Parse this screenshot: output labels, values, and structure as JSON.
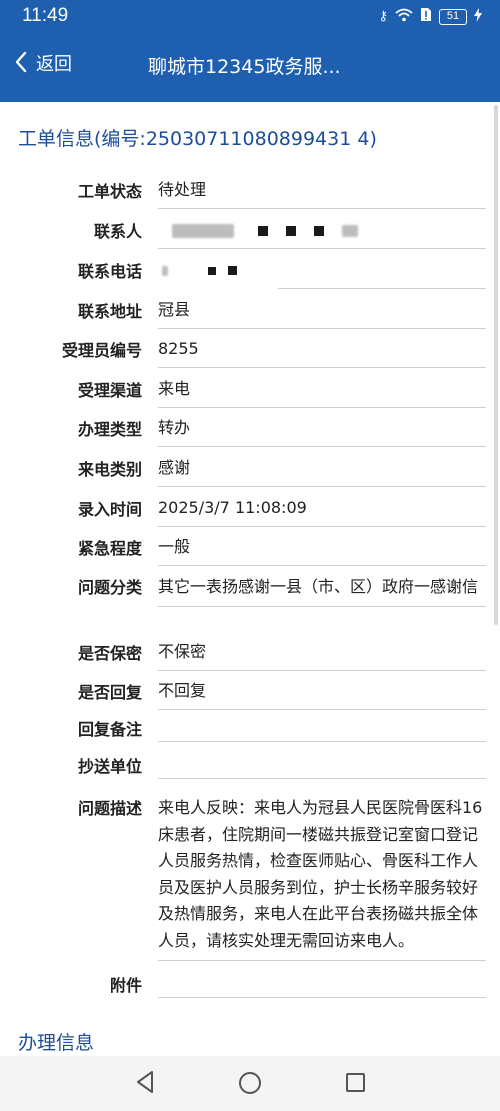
{
  "status_bar": {
    "time": "11:49",
    "battery": "51",
    "icons": [
      "key-icon",
      "wifi-icon",
      "sim-alert-icon",
      "battery-icon",
      "charging-icon"
    ]
  },
  "app_bar": {
    "back_label": "返回",
    "title": "聊城市12345政务服..."
  },
  "ticket_section_title": "工单信息(编号:25030711080899431 4)",
  "fields": {
    "status": {
      "label": "工单状态",
      "value": "待处理"
    },
    "contact": {
      "label": "联系人"
    },
    "phone": {
      "label": "联系电话"
    },
    "address": {
      "label": "联系地址",
      "value": "冠县"
    },
    "operator_id": {
      "label": "受理员编号",
      "value": "8255"
    },
    "channel": {
      "label": "受理渠道",
      "value": "来电"
    },
    "handle_type": {
      "label": "办理类型",
      "value": "转办"
    },
    "call_type": {
      "label": "来电类别",
      "value": "感谢"
    },
    "entry_time": {
      "label": "录入时间",
      "value": "2025/3/7 11:08:09"
    },
    "urgency": {
      "label": "紧急程度",
      "value": "一般"
    },
    "category": {
      "label": "问题分类",
      "value": "其它一表扬感谢一县（市、区）政府一感谢信"
    },
    "confidential": {
      "label": "是否保密",
      "value": "不保密"
    },
    "reply": {
      "label": "是否回复",
      "value": "不回复"
    },
    "reply_note": {
      "label": "回复备注",
      "value": ""
    },
    "cc_unit": {
      "label": "抄送单位",
      "value": ""
    },
    "description": {
      "label": "问题描述",
      "value": "来电人反映：来电人为冠县人民医院骨医科16床患者，住院期间一楼磁共振登记室窗口登记人员服务热情，检查医师贴心、骨医科工作人员及医护人员服务到位，护士长杨辛服务较好及热情服务，来电人在此平台表扬磁共振全体人员，请核实处理无需回访来电人。"
    },
    "attachment": {
      "label": "附件",
      "value": ""
    }
  },
  "process_section_title": "办理信息",
  "colors": {
    "header_bg": "#1f5fb0",
    "section_title": "#1c4e9a",
    "divider": "#cfcfcf"
  }
}
